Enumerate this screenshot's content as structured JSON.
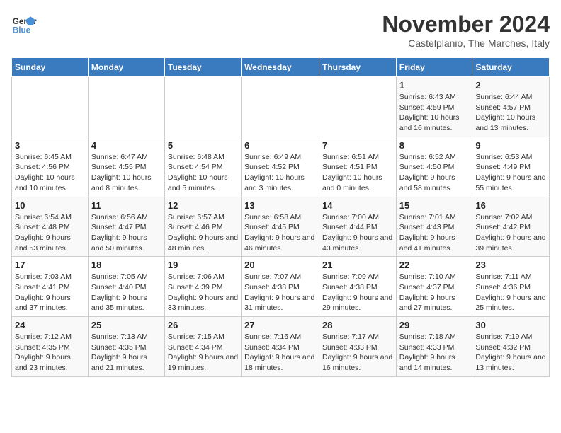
{
  "logo": {
    "line1": "General",
    "line2": "Blue"
  },
  "title": "November 2024",
  "location": "Castelplanio, The Marches, Italy",
  "weekdays": [
    "Sunday",
    "Monday",
    "Tuesday",
    "Wednesday",
    "Thursday",
    "Friday",
    "Saturday"
  ],
  "weeks": [
    [
      {
        "day": "",
        "info": ""
      },
      {
        "day": "",
        "info": ""
      },
      {
        "day": "",
        "info": ""
      },
      {
        "day": "",
        "info": ""
      },
      {
        "day": "",
        "info": ""
      },
      {
        "day": "1",
        "info": "Sunrise: 6:43 AM\nSunset: 4:59 PM\nDaylight: 10 hours and 16 minutes."
      },
      {
        "day": "2",
        "info": "Sunrise: 6:44 AM\nSunset: 4:57 PM\nDaylight: 10 hours and 13 minutes."
      }
    ],
    [
      {
        "day": "3",
        "info": "Sunrise: 6:45 AM\nSunset: 4:56 PM\nDaylight: 10 hours and 10 minutes."
      },
      {
        "day": "4",
        "info": "Sunrise: 6:47 AM\nSunset: 4:55 PM\nDaylight: 10 hours and 8 minutes."
      },
      {
        "day": "5",
        "info": "Sunrise: 6:48 AM\nSunset: 4:54 PM\nDaylight: 10 hours and 5 minutes."
      },
      {
        "day": "6",
        "info": "Sunrise: 6:49 AM\nSunset: 4:52 PM\nDaylight: 10 hours and 3 minutes."
      },
      {
        "day": "7",
        "info": "Sunrise: 6:51 AM\nSunset: 4:51 PM\nDaylight: 10 hours and 0 minutes."
      },
      {
        "day": "8",
        "info": "Sunrise: 6:52 AM\nSunset: 4:50 PM\nDaylight: 9 hours and 58 minutes."
      },
      {
        "day": "9",
        "info": "Sunrise: 6:53 AM\nSunset: 4:49 PM\nDaylight: 9 hours and 55 minutes."
      }
    ],
    [
      {
        "day": "10",
        "info": "Sunrise: 6:54 AM\nSunset: 4:48 PM\nDaylight: 9 hours and 53 minutes."
      },
      {
        "day": "11",
        "info": "Sunrise: 6:56 AM\nSunset: 4:47 PM\nDaylight: 9 hours and 50 minutes."
      },
      {
        "day": "12",
        "info": "Sunrise: 6:57 AM\nSunset: 4:46 PM\nDaylight: 9 hours and 48 minutes."
      },
      {
        "day": "13",
        "info": "Sunrise: 6:58 AM\nSunset: 4:45 PM\nDaylight: 9 hours and 46 minutes."
      },
      {
        "day": "14",
        "info": "Sunrise: 7:00 AM\nSunset: 4:44 PM\nDaylight: 9 hours and 43 minutes."
      },
      {
        "day": "15",
        "info": "Sunrise: 7:01 AM\nSunset: 4:43 PM\nDaylight: 9 hours and 41 minutes."
      },
      {
        "day": "16",
        "info": "Sunrise: 7:02 AM\nSunset: 4:42 PM\nDaylight: 9 hours and 39 minutes."
      }
    ],
    [
      {
        "day": "17",
        "info": "Sunrise: 7:03 AM\nSunset: 4:41 PM\nDaylight: 9 hours and 37 minutes."
      },
      {
        "day": "18",
        "info": "Sunrise: 7:05 AM\nSunset: 4:40 PM\nDaylight: 9 hours and 35 minutes."
      },
      {
        "day": "19",
        "info": "Sunrise: 7:06 AM\nSunset: 4:39 PM\nDaylight: 9 hours and 33 minutes."
      },
      {
        "day": "20",
        "info": "Sunrise: 7:07 AM\nSunset: 4:38 PM\nDaylight: 9 hours and 31 minutes."
      },
      {
        "day": "21",
        "info": "Sunrise: 7:09 AM\nSunset: 4:38 PM\nDaylight: 9 hours and 29 minutes."
      },
      {
        "day": "22",
        "info": "Sunrise: 7:10 AM\nSunset: 4:37 PM\nDaylight: 9 hours and 27 minutes."
      },
      {
        "day": "23",
        "info": "Sunrise: 7:11 AM\nSunset: 4:36 PM\nDaylight: 9 hours and 25 minutes."
      }
    ],
    [
      {
        "day": "24",
        "info": "Sunrise: 7:12 AM\nSunset: 4:35 PM\nDaylight: 9 hours and 23 minutes."
      },
      {
        "day": "25",
        "info": "Sunrise: 7:13 AM\nSunset: 4:35 PM\nDaylight: 9 hours and 21 minutes."
      },
      {
        "day": "26",
        "info": "Sunrise: 7:15 AM\nSunset: 4:34 PM\nDaylight: 9 hours and 19 minutes."
      },
      {
        "day": "27",
        "info": "Sunrise: 7:16 AM\nSunset: 4:34 PM\nDaylight: 9 hours and 18 minutes."
      },
      {
        "day": "28",
        "info": "Sunrise: 7:17 AM\nSunset: 4:33 PM\nDaylight: 9 hours and 16 minutes."
      },
      {
        "day": "29",
        "info": "Sunrise: 7:18 AM\nSunset: 4:33 PM\nDaylight: 9 hours and 14 minutes."
      },
      {
        "day": "30",
        "info": "Sunrise: 7:19 AM\nSunset: 4:32 PM\nDaylight: 9 hours and 13 minutes."
      }
    ]
  ]
}
